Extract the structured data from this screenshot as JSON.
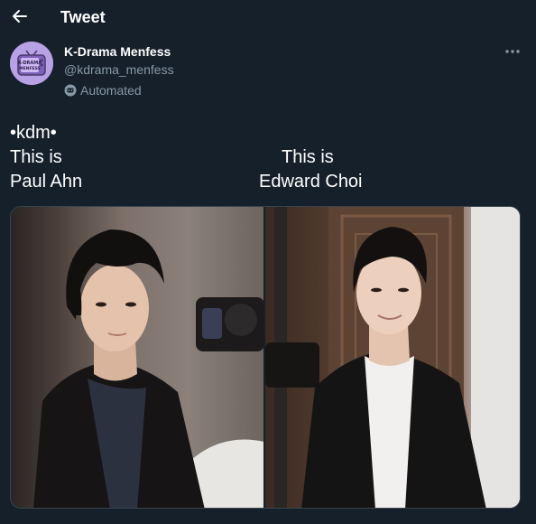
{
  "header": {
    "title": "Tweet"
  },
  "author": {
    "display_name": "K-Drama Menfess",
    "handle": "@kdrama_menfess",
    "automated_label": "Automated",
    "avatar_text_line1": "K-DRAMA",
    "avatar_text_line2": "MENFESS"
  },
  "tweet": {
    "line1": "•kdm•",
    "left_line1": "This is",
    "left_line2": "Paul Ahn",
    "right_line1": "This is",
    "right_line2": "Edward Choi"
  },
  "media": {
    "photos": [
      {
        "description_icon": "photo-paul-ahn"
      },
      {
        "description_icon": "photo-edward-choi"
      }
    ]
  },
  "colors": {
    "background": "#15202b",
    "secondary_text": "#8899a6",
    "avatar_bg": "#b9a1e6"
  }
}
